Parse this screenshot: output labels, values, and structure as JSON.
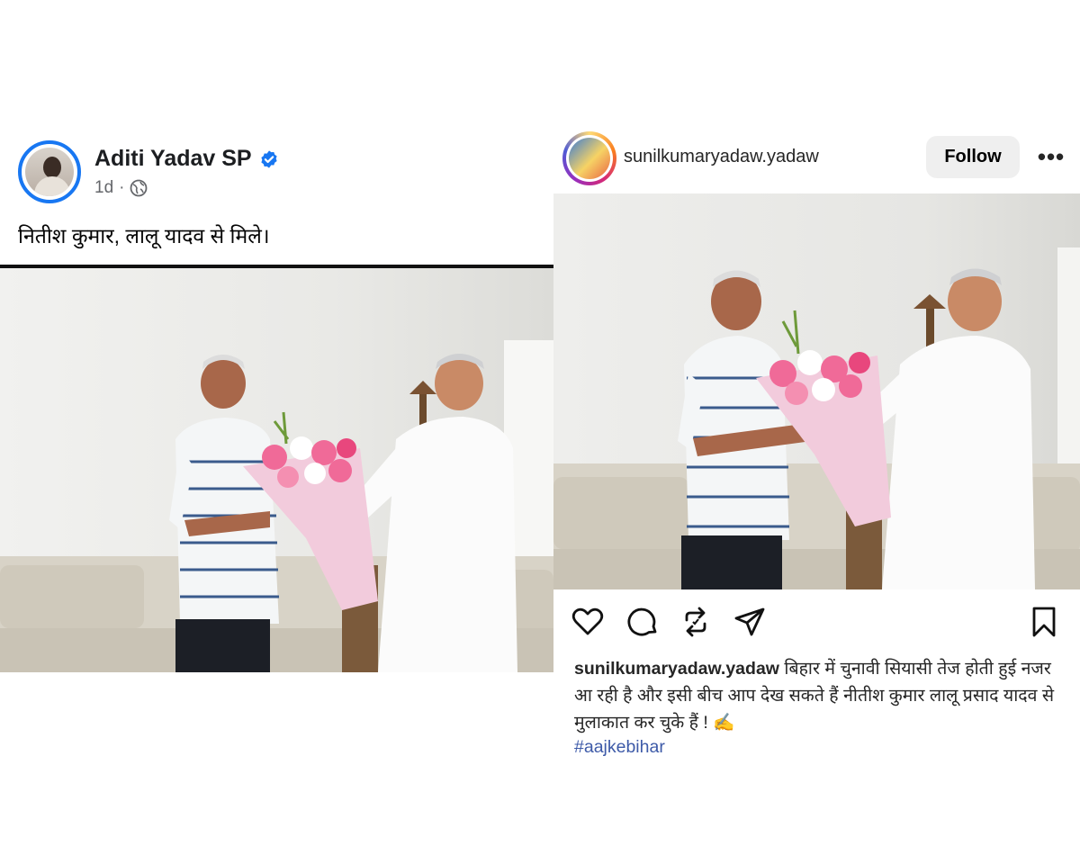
{
  "left_post": {
    "author": "Aditi Yadav SP",
    "time": "1d",
    "separator": "·",
    "caption": "नितीश कुमार, लालू यादव से मिले।",
    "icons": [
      "verified-badge-icon",
      "globe-icon"
    ],
    "colors": {
      "accent": "#1877f2",
      "meta": "#65676b"
    }
  },
  "right_post": {
    "username": "sunilkumaryadaw.yadaw",
    "follow_label": "Follow",
    "more_label": "•••",
    "caption_user": "sunilkumaryadaw.yadaw",
    "caption_text": "बिहार में चुनावी सियासी तेज होती हुई नजर आ रही है और इसी बीच आप देख सकते हैं नीतीश कुमार लालू प्रसाद यादव से मुलाकात कर चुके हैं ! ✍️",
    "hashtag": "#aajkebihar",
    "icons": [
      "heart-icon",
      "comment-icon",
      "repost-icon",
      "share-icon",
      "bookmark-icon"
    ],
    "colors": {
      "hashtag": "#3d5aa8",
      "follow_bg": "#efefef"
    }
  }
}
